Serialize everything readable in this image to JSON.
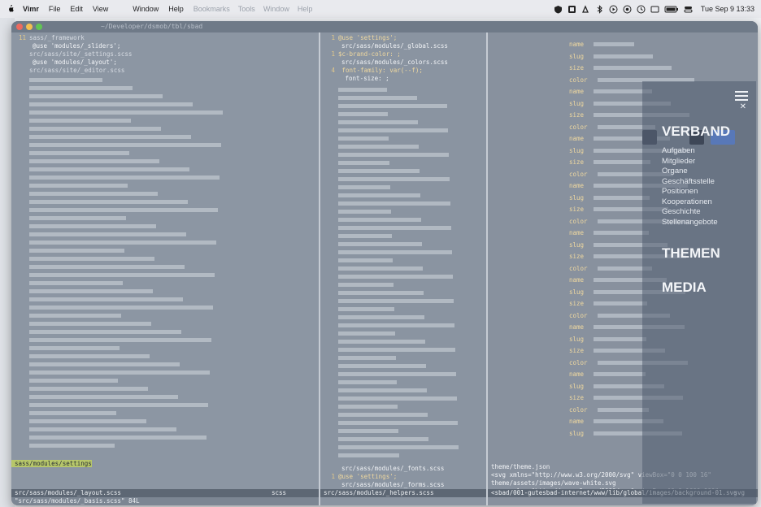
{
  "menubar": {
    "app": "Vimr",
    "items": [
      "File",
      "Edit",
      "View",
      "Window",
      "Help"
    ],
    "ghost_items": [
      "Bookmarks",
      "Tools",
      "Window",
      "Help"
    ],
    "clock": "Tue Sep 9  13:33"
  },
  "vim": {
    "title_ghost": "~/Developer/dsmob/tbl/sbad",
    "pane1": {
      "header_lines": [
        {
          "n": "11",
          "t": "sass/_framework"
        },
        {
          "n": "",
          "t": "@use 'modules/_sliders';"
        },
        {
          "n": "",
          "t": "src/sass/site/_settings.scss"
        },
        {
          "n": "",
          "t": "@use 'modules/_layout';"
        },
        {
          "n": "",
          "t": "src/sass/site/_editor.scss"
        }
      ],
      "hl_label": "sass/modules/settings",
      "status_path": "src/sass/modules/_layout.scss",
      "status_ft": "scss",
      "cmd": "\"src/sass/modules/_basis.scss\" 84L"
    },
    "pane2": {
      "header_lines": [
        {
          "n": "1",
          "t": "@use 'settings';"
        },
        {
          "n": "",
          "t": "src/sass/modules/_global.scss"
        },
        {
          "n": "1",
          "t": "$c-brand-color: ;"
        },
        {
          "n": "",
          "t": "src/sass/modules/_colors.scss"
        },
        {
          "n": "4",
          "t": "  font-family: var(--f);"
        },
        {
          "n": "",
          "t": "  font-size: ;"
        }
      ],
      "footer_lines": [
        {
          "n": "",
          "t": "src/sass/modules/_fonts.scss"
        },
        {
          "n": "1",
          "t": "@use 'settings';"
        },
        {
          "n": "",
          "t": "src/sass/modules/_forms.scss"
        }
      ],
      "status_path": "src/sass/modules/_helpers.scss"
    },
    "pane3": {
      "keys": [
        "name",
        "slug",
        "size",
        "color",
        "name",
        "slug",
        "size",
        "color",
        "name",
        "slug",
        "size",
        "color",
        "name",
        "slug",
        "size",
        "color",
        "name",
        "slug",
        "size",
        "color",
        "name",
        "slug",
        "size",
        "color",
        "name",
        "slug",
        "size",
        "color",
        "name",
        "slug",
        "size",
        "color",
        "name",
        "slug"
      ],
      "footer": [
        "theme/theme.json",
        "  <svg xmlns=\"http://www.w3.org/2000/svg\" viewBox=\"0 0 100 16\"",
        "theme/assets/images/wave-white.svg",
        "  <svg xmlns=\"http://www.w3.org/2000/svg\" viewBox=\"0 0 1600 900\""
      ],
      "status_path": "<sbad/001-gutesbad-internet/www/lib/global/images/background-01.svg",
      "status_ft": "svg"
    }
  },
  "site": {
    "h1": "VERBAND",
    "links": [
      "Aufgaben",
      "Mitglieder",
      "Organe",
      "Geschäftsstelle",
      "Positionen",
      "Kooperationen",
      "Geschichte",
      "Stellenangebote"
    ],
    "h2": "THEMEN",
    "h3": "MEDIA"
  }
}
